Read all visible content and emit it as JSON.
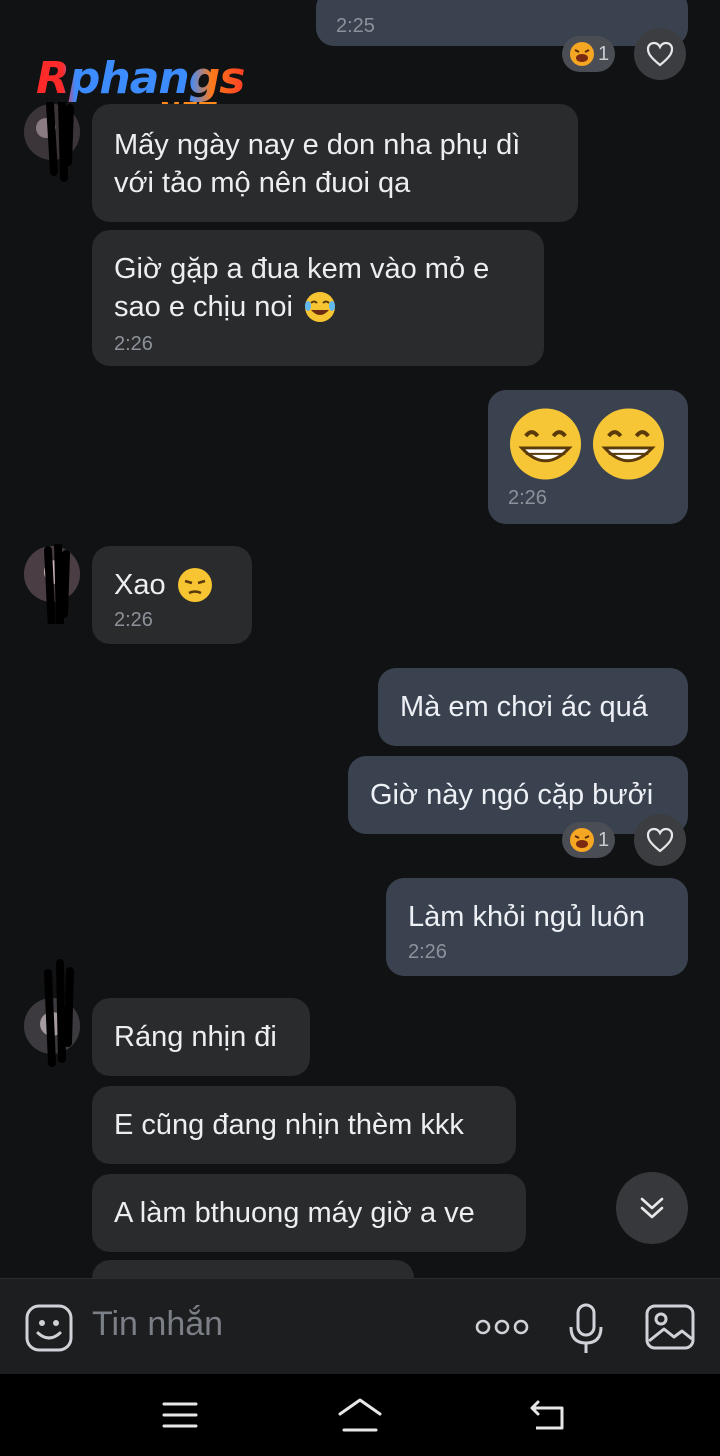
{
  "watermark": {
    "brand": "Rphangs",
    "suffix": ".NET"
  },
  "messages": [
    {
      "id": "m0",
      "dir": "out",
      "text": "",
      "time": "2:25"
    },
    {
      "id": "m1",
      "dir": "in",
      "lines": [
        "Mấy ngày nay e don nha phụ dì",
        "với tảo mộ nên đuoi qa"
      ]
    },
    {
      "id": "m2",
      "dir": "in",
      "lines": [
        "Giờ gặp a đua kem vào mỏ e",
        "sao e chịu noi"
      ],
      "time": "2:26"
    },
    {
      "id": "m3",
      "dir": "out",
      "emoji": "😁😁",
      "time": "2:26"
    },
    {
      "id": "m4",
      "dir": "in",
      "text": "Xao",
      "time": "2:26"
    },
    {
      "id": "m5",
      "dir": "out",
      "text": "Mà em chơi ác quá"
    },
    {
      "id": "m6",
      "dir": "out",
      "text": "Giờ này ngó cặp bưởi"
    },
    {
      "id": "m7",
      "dir": "out",
      "text": "Làm khỏi ngủ luôn",
      "time": "2:26"
    },
    {
      "id": "m8",
      "dir": "in",
      "text": "Ráng nhịn đi"
    },
    {
      "id": "m9",
      "dir": "in",
      "text": "E cũng đang nhịn thèm kkk"
    },
    {
      "id": "m10",
      "dir": "in",
      "text": "A làm bthuong máy giờ a ve"
    }
  ],
  "reactions": [
    {
      "count": "1"
    },
    {
      "count": "1"
    }
  ],
  "composer": {
    "placeholder": "Tin nhắn"
  },
  "colors": {
    "incoming": "#2a2b2d",
    "outgoing": "#3a4250",
    "background": "#111213"
  }
}
